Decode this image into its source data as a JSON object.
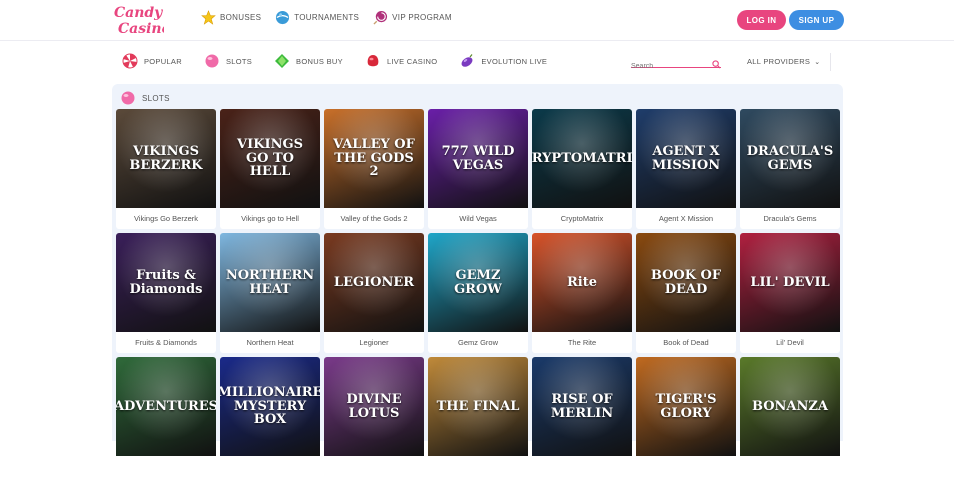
{
  "brand": {
    "logo_text": "Candy Casino",
    "accent": "#e8457f",
    "blue": "#3d8ee2"
  },
  "topnav": [
    {
      "label": "BONUSES",
      "icon": "star-icon"
    },
    {
      "label": "TOURNAMENTS",
      "icon": "globe-candy-icon"
    },
    {
      "label": "VIP PROGRAM",
      "icon": "lollipop-icon"
    }
  ],
  "auth": {
    "login": "LOG IN",
    "signup": "SIGN UP"
  },
  "categories": [
    {
      "label": "POPULAR",
      "icon": "peppermint-icon"
    },
    {
      "label": "SLOTS",
      "icon": "pink-candy-icon"
    },
    {
      "label": "BONUS BUY",
      "icon": "green-gem-icon"
    },
    {
      "label": "LIVE CASINO",
      "icon": "red-candy-icon"
    },
    {
      "label": "EVOLUTION LIVE",
      "icon": "purple-jellybean-icon"
    }
  ],
  "search": {
    "placeholder": "Search"
  },
  "providers": {
    "label": "ALL PROVIDERS"
  },
  "section": {
    "title": "SLOTS"
  },
  "games": [
    {
      "name": "Vikings Go Berzerk",
      "thumb_text": "VIKINGS BERZERK",
      "bg": "#5b4a3a"
    },
    {
      "name": "Vikings go to Hell",
      "thumb_text": "VIKINGS GO TO HELL",
      "bg": "#4a2218"
    },
    {
      "name": "Valley of the Gods 2",
      "thumb_text": "VALLEY OF THE GODS 2",
      "bg": "#c9702a"
    },
    {
      "name": "Wild Vegas",
      "thumb_text": "777 WILD VEGAS",
      "bg": "#6a1fa8"
    },
    {
      "name": "CryptoMatrix",
      "thumb_text": "CRYPTOMATRIX",
      "bg": "#0b3a4a"
    },
    {
      "name": "Agent X Mission",
      "thumb_text": "AGENT X MISSION",
      "bg": "#1f3d6b"
    },
    {
      "name": "Dracula's Gems",
      "thumb_text": "DRACULA'S GEMS",
      "bg": "#2f4a60"
    },
    {
      "name": "Fruits & Diamonds",
      "thumb_text": "Fruits & Diamonds",
      "bg": "#3a1f5a"
    },
    {
      "name": "Northern Heat",
      "thumb_text": "NORTHERN HEAT",
      "bg": "#7fb7e0"
    },
    {
      "name": "Legioner",
      "thumb_text": "LEGIONER",
      "bg": "#7a3a20"
    },
    {
      "name": "Gemz Grow",
      "thumb_text": "GEMZ GROW",
      "bg": "#1fa6c9"
    },
    {
      "name": "The Rite",
      "thumb_text": "Rite",
      "bg": "#d8532a"
    },
    {
      "name": "Book of Dead",
      "thumb_text": "BOOK OF DEAD",
      "bg": "#8a4a10"
    },
    {
      "name": "Lil' Devil",
      "thumb_text": "LIL' DEVIL",
      "bg": "#b02040"
    },
    {
      "name": "",
      "thumb_text": "ADVENTURES",
      "bg": "#2f6a3a"
    },
    {
      "name": "",
      "thumb_text": "MILLIONAIRE MYSTERY BOX",
      "bg": "#1a2a8a"
    },
    {
      "name": "",
      "thumb_text": "DIVINE LOTUS",
      "bg": "#7a3a8a"
    },
    {
      "name": "",
      "thumb_text": "THE FINAL",
      "bg": "#c08a3a"
    },
    {
      "name": "",
      "thumb_text": "RISE OF MERLIN",
      "bg": "#1a3a6a"
    },
    {
      "name": "",
      "thumb_text": "TIGER'S GLORY",
      "bg": "#c06a20"
    },
    {
      "name": "",
      "thumb_text": "BONANZA",
      "bg": "#5a7a2a"
    }
  ]
}
